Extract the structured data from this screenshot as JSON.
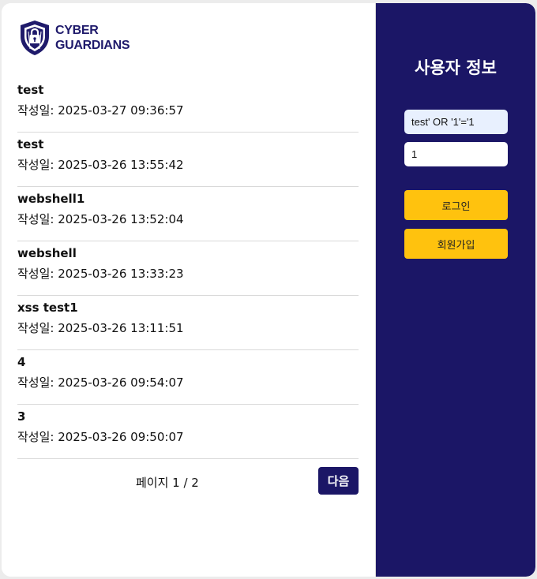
{
  "logo": {
    "line1": "CYBER",
    "line2": "GUARDIANS"
  },
  "posts": [
    {
      "title": "test",
      "date": "작성일: 2025-03-27 09:36:57"
    },
    {
      "title": "test",
      "date": "작성일: 2025-03-26 13:55:42"
    },
    {
      "title": "webshell1",
      "date": "작성일: 2025-03-26 13:52:04"
    },
    {
      "title": "webshell",
      "date": "작성일: 2025-03-26 13:33:23"
    },
    {
      "title": "xss test1",
      "date": "작성일: 2025-03-26 13:11:51"
    },
    {
      "title": "4",
      "date": "작성일: 2025-03-26 09:54:07"
    },
    {
      "title": "3",
      "date": "작성일: 2025-03-26 09:50:07"
    }
  ],
  "pagination": {
    "info": "페이지 1 / 2",
    "next_label": "다음"
  },
  "user_panel": {
    "title": "사용자 정보",
    "username_value": "test' OR '1'='1",
    "password_value": "1",
    "login_label": "로그인",
    "signup_label": "회원가입"
  },
  "colors": {
    "navy": "#1b1666",
    "yellow": "#ffc20e",
    "autofill": "#e8f0fe"
  }
}
